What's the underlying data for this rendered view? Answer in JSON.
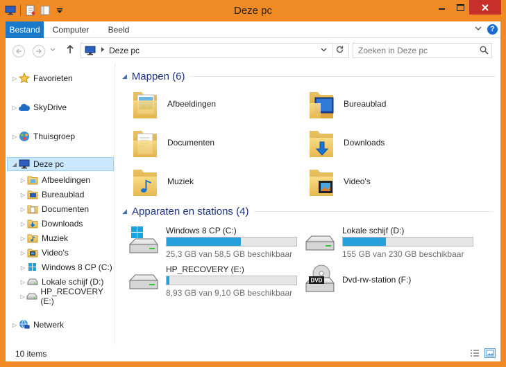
{
  "window": {
    "title": "Deze pc"
  },
  "ribbon": {
    "tabs": [
      "Bestand",
      "Computer",
      "Beeld"
    ]
  },
  "address": {
    "path": "Deze pc"
  },
  "search": {
    "placeholder": "Zoeken in Deze pc"
  },
  "nav": {
    "top": [
      {
        "label": "Favorieten",
        "icon": "star-icon"
      },
      {
        "label": "SkyDrive",
        "icon": "cloud-icon"
      },
      {
        "label": "Thuisgroep",
        "icon": "homegroup-icon"
      }
    ],
    "this_pc": {
      "label": "Deze pc",
      "icon": "computer-icon"
    },
    "children": [
      {
        "label": "Afbeeldingen",
        "icon": "pictures-folder-icon"
      },
      {
        "label": "Bureaublad",
        "icon": "desktop-folder-icon"
      },
      {
        "label": "Documenten",
        "icon": "documents-folder-icon"
      },
      {
        "label": "Downloads",
        "icon": "downloads-folder-icon"
      },
      {
        "label": "Muziek",
        "icon": "music-folder-icon"
      },
      {
        "label": "Video's",
        "icon": "videos-folder-icon"
      },
      {
        "label": "Windows 8 CP (C:)",
        "icon": "windows-drive-icon"
      },
      {
        "label": "Lokale schijf (D:)",
        "icon": "drive-icon"
      },
      {
        "label": "HP_RECOVERY (E:)",
        "icon": "drive-icon"
      }
    ],
    "network": {
      "label": "Netwerk",
      "icon": "network-icon"
    }
  },
  "groups": {
    "folders": {
      "title": "Mappen (6)"
    },
    "devices": {
      "title": "Apparaten en stations (4)"
    }
  },
  "folders": [
    {
      "name": "Afbeeldingen",
      "icon": "pictures-folder-icon"
    },
    {
      "name": "Bureaublad",
      "icon": "desktop-folder-icon"
    },
    {
      "name": "Documenten",
      "icon": "documents-folder-icon"
    },
    {
      "name": "Downloads",
      "icon": "downloads-folder-icon"
    },
    {
      "name": "Muziek",
      "icon": "music-folder-icon"
    },
    {
      "name": "Video's",
      "icon": "videos-folder-icon"
    }
  ],
  "drives": [
    {
      "name": "Windows 8 CP (C:)",
      "free": "25,3 GB van 58,5 GB beschikbaar",
      "used_fraction": 0.57,
      "icon": "windows-drive-icon"
    },
    {
      "name": "Lokale schijf (D:)",
      "free": "155 GB van 230 GB beschikbaar",
      "used_fraction": 0.33,
      "icon": "drive-icon"
    },
    {
      "name": "HP_RECOVERY (E:)",
      "free": "8,93 GB van 9,10 GB beschikbaar",
      "used_fraction": 0.02,
      "icon": "drive-icon"
    },
    {
      "name": "Dvd-rw-station (F:)",
      "icon": "dvd-drive-icon",
      "badge": "DVD"
    }
  ],
  "status": {
    "items": "10 items"
  },
  "colors": {
    "titlebar": "#f08a24",
    "accent": "#1979ca",
    "bar_fill": "#26a0da",
    "group_title": "#1e3287"
  }
}
